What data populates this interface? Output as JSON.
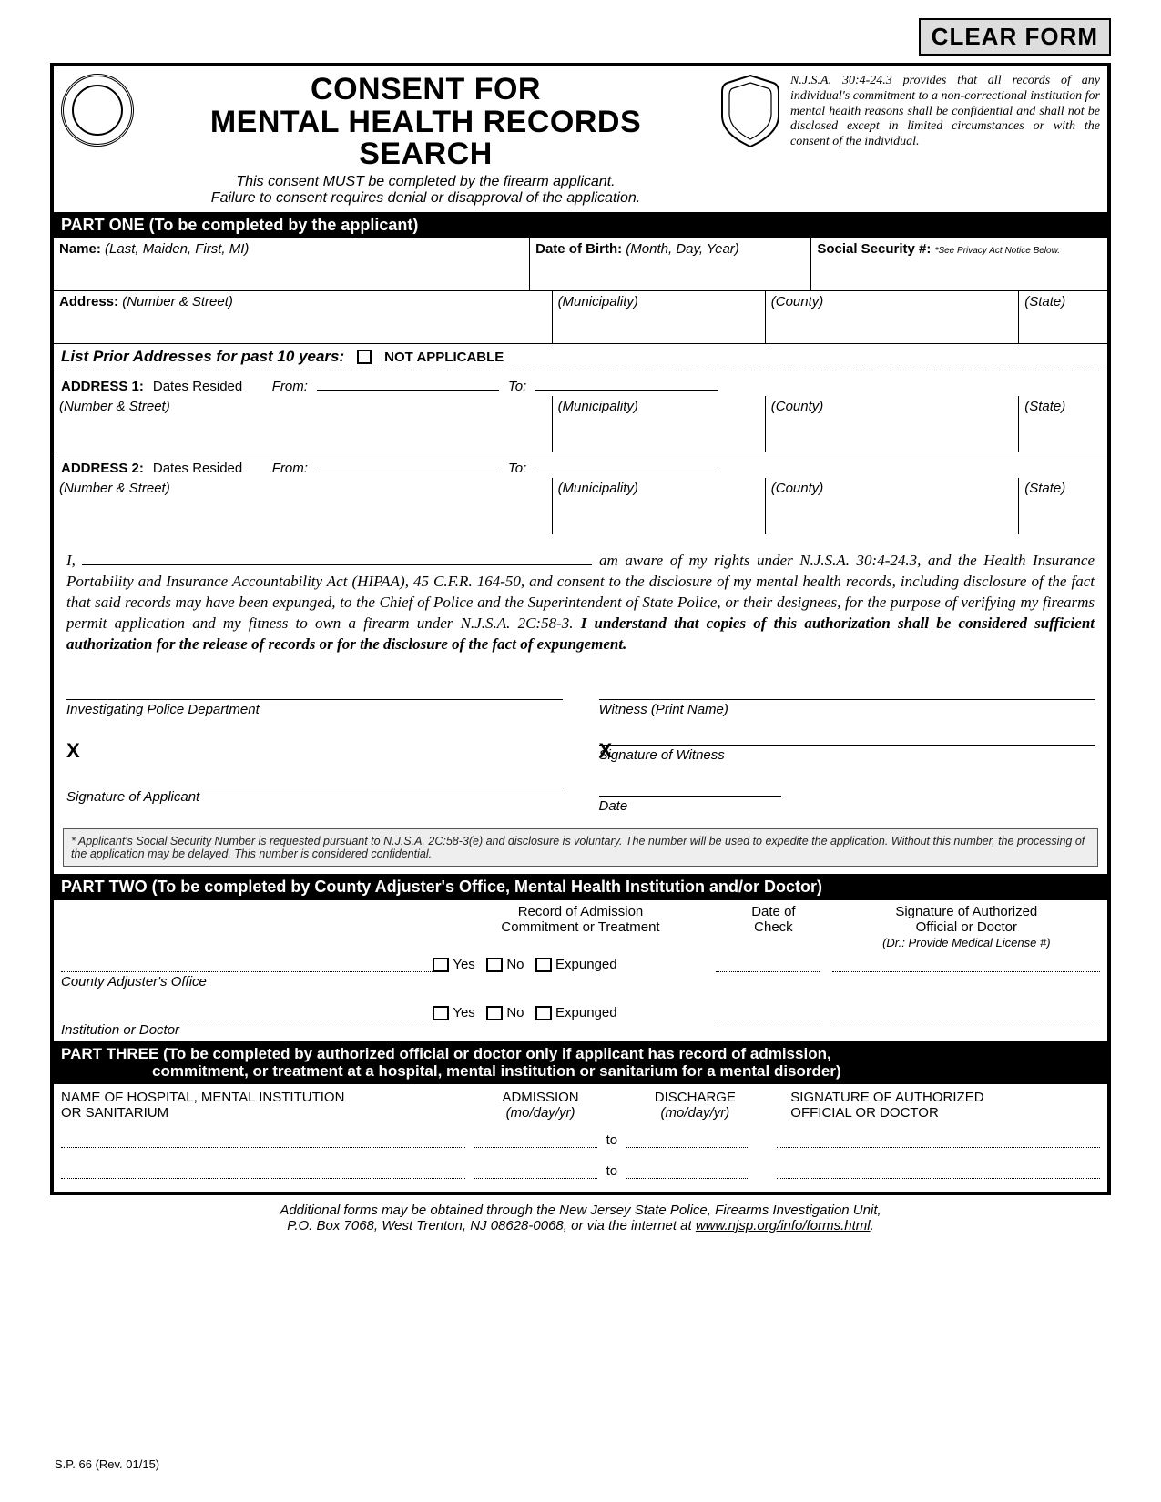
{
  "clear_button": "CLEAR FORM",
  "header": {
    "title_l1": "CONSENT FOR",
    "title_l2": "MENTAL HEALTH RECORDS SEARCH",
    "sub1": "This consent MUST be completed by the firearm applicant.",
    "sub2": "Failure to consent requires denial or disapproval of the application.",
    "legal": "N.J.S.A. 30:4-24.3 provides that all records of any individual's commitment to a non-correctional institution for mental health reasons shall be confidential and shall not be disclosed except in limited circumstances or with the consent of the individual."
  },
  "part1": {
    "bar": "PART ONE (To be completed by the applicant)",
    "name_lbl": "Name:",
    "name_hint": "(Last, Maiden, First, MI)",
    "dob_lbl": "Date of Birth:",
    "dob_hint": "(Month, Day, Year)",
    "ssn_lbl": "Social Security #:",
    "ssn_hint": "*See Privacy Act Notice Below.",
    "addr_lbl": "Address:",
    "addr_hint": "(Number & Street)",
    "muni": "(Municipality)",
    "county": "(County)",
    "state": "(State)",
    "prior_hdr": "List Prior Addresses for past 10 years:",
    "na": "NOT APPLICABLE",
    "addr1": "ADDRESS 1:",
    "addr2": "ADDRESS 2:",
    "dates_resided": "Dates Resided",
    "from": "From:",
    "to": "To:",
    "ns": "(Number & Street)"
  },
  "consent": {
    "pre": "I,",
    "post": "am aware of my rights under N.J.S.A. 30:4-24.3, and the Health Insurance Portability and Insurance Accountability Act (HIPAA), 45 C.F.R. 164-50, and consent to the disclosure of my mental health records, including disclosure of the fact that said records may have been expunged, to the Chief of Police and the Superintendent of State Police, or their designees, for the purpose of verifying my firearms permit application and my fitness to own a firearm under N.J.S.A. 2C:58-3.",
    "bold": "I understand that copies of this authorization shall be considered sufficient authorization for the release of records or for the disclosure of the fact of expungement.",
    "ipd": "Investigating Police Department",
    "witness_print": "Witness (Print Name)",
    "witness_sig": "Signature of Witness",
    "applicant_sig": "Signature of Applicant",
    "date": "Date"
  },
  "ssn_note": "* Applicant's Social Security Number is requested pursuant to N.J.S.A. 2C:58-3(e) and disclosure is voluntary. The number will be used to expedite the application. Without this number, the processing of the application may be delayed. This number is considered confidential.",
  "part2": {
    "bar": "PART TWO (To be completed by County Adjuster's Office, Mental Health Institution and/or Doctor)",
    "col_record_l1": "Record of Admission",
    "col_record_l2": "Commitment or Treatment",
    "col_date_l1": "Date of",
    "col_date_l2": "Check",
    "col_sig_l1": "Signature of Authorized",
    "col_sig_l2": "Official or Doctor",
    "col_sig_l3": "(Dr.: Provide Medical License #)",
    "yes": "Yes",
    "no": "No",
    "expunged": "Expunged",
    "county_adj": "County Adjuster's Office",
    "inst": "Institution or Doctor"
  },
  "part3": {
    "bar_l1": "PART THREE (To be completed by authorized official or doctor only if applicant has record of admission,",
    "bar_l2": "commitment, or treatment at a hospital, mental institution or sanitarium for a mental disorder)",
    "col1_l1": "NAME OF HOSPITAL, MENTAL INSTITUTION",
    "col1_l2": "OR SANITARIUM",
    "col2_l1": "ADMISSION",
    "col2_l2": "(mo/day/yr)",
    "col3_l1": "DISCHARGE",
    "col3_l2": "(mo/day/yr)",
    "col4_l1": "SIGNATURE OF AUTHORIZED",
    "col4_l2": "OFFICIAL OR DOCTOR",
    "to": "to"
  },
  "footer": {
    "l1": "Additional forms may be obtained through the New Jersey State Police, Firearms Investigation Unit,",
    "l2_a": "P.O. Box 7068, West Trenton, NJ 08628-0068, or via the internet at ",
    "l2_link": "www.njsp.org/info/forms.html",
    "l2_b": "."
  },
  "form_no": "S.P. 66 (Rev. 01/15)"
}
